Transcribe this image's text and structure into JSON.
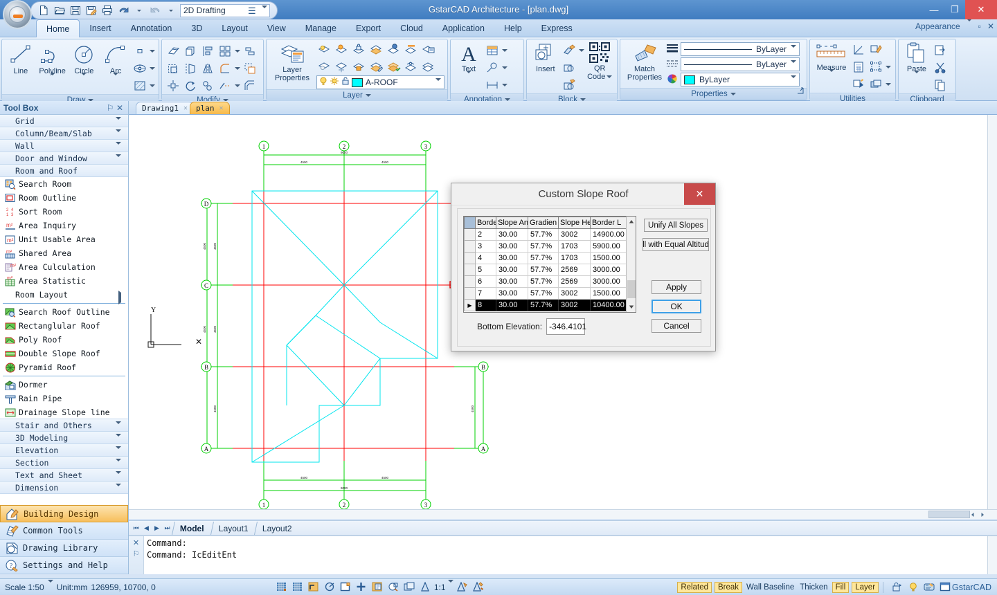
{
  "window": {
    "title": "GstarCAD Architecture - [plan.dwg]",
    "minimize": "—",
    "maximize": "❐",
    "close": "✕"
  },
  "quick_access": {
    "workspace_value": "2D Drafting",
    "icons": [
      "new-icon",
      "open-icon",
      "save-icon",
      "save-as-icon",
      "print-icon",
      "undo-icon",
      "redo-icon"
    ],
    "more_label": "☰"
  },
  "ribbon": {
    "tabs": [
      {
        "label": "Home",
        "active": true
      },
      {
        "label": "Insert",
        "active": false
      },
      {
        "label": "Annotation",
        "active": false
      },
      {
        "label": "3D",
        "active": false
      },
      {
        "label": "Layout",
        "active": false
      },
      {
        "label": "View",
        "active": false
      },
      {
        "label": "Manage",
        "active": false
      },
      {
        "label": "Export",
        "active": false
      },
      {
        "label": "Cloud",
        "active": false
      },
      {
        "label": "Application",
        "active": false
      },
      {
        "label": "Help",
        "active": false
      },
      {
        "label": "Express",
        "active": false
      }
    ],
    "appearance_label": "Appearance",
    "panels": {
      "draw": {
        "title": "Draw",
        "buttons": [
          "Line",
          "Polyline",
          "Circle",
          "Arc"
        ],
        "extra_icons": [
          "rectangle-icon",
          "ellipse-icon",
          "hatch-icon"
        ]
      },
      "modify": {
        "title": "Modify",
        "icons": [
          "erase-icon",
          "copy-icon",
          "align-icon",
          "array-icon",
          "offset-icon",
          "scale-icon",
          "stretch-icon",
          "mirror-icon",
          "fillet-icon",
          "explode-icon",
          "move-icon",
          "rotate-icon",
          "trim-icon",
          "extend-icon",
          "chamfer-icon"
        ]
      },
      "layer": {
        "title": "Layer",
        "main_label_line1": "Layer",
        "main_label_line2": "Properties",
        "current_layer": "A-ROOF",
        "layer_color": "#00ffff",
        "icons": [
          "layer-on-icon",
          "layer-freeze-icon",
          "layer-lock-icon",
          "layer-iso-icon",
          "layer-match-icon",
          "layer-prev-icon",
          "layer-state-icon",
          "layer-off-icon",
          "layer-thaw-icon",
          "layer-unlock-icon",
          "layer-change-icon",
          "layer-merge-icon",
          "layer-walk-icon",
          "layer-delete-icon"
        ]
      },
      "annotation": {
        "title": "Annotation",
        "main_label": "Text",
        "icons": [
          "table-icon",
          "leader-icon",
          "dimension-icon"
        ]
      },
      "block": {
        "title": "Block",
        "insert_label": "Insert",
        "qr_label_line1": "QR",
        "qr_label_line2": "Code",
        "icons": [
          "block-edit-icon",
          "block-define-icon",
          "block-attribute-icon",
          "qr-code-icon"
        ]
      },
      "properties": {
        "title": "Properties",
        "match_label_line1": "Match",
        "match_label_line2": "Properties",
        "color_value": "ByLayer",
        "linetype_value": "ByLayer",
        "lineweight_value": "ByLayer",
        "swatch_color": "#00ffff"
      },
      "utilities": {
        "title": "Utilities",
        "measure_label": "Measure",
        "icons": [
          "distance-icon",
          "ruler-icon",
          "coordinate-icon",
          "quick-select-icon",
          "calculator-icon",
          "point-icon",
          "group-icon",
          "overlap-icon"
        ]
      },
      "clipboard": {
        "title": "Clipboard",
        "paste_label": "Paste",
        "icons": [
          "copy-clip-icon",
          "cut-icon",
          "copy-icon"
        ]
      }
    }
  },
  "document_tabs": [
    {
      "label": "Drawing1",
      "active": false,
      "close": "✕"
    },
    {
      "label": "plan",
      "active": true,
      "close": "✕"
    }
  ],
  "toolbox": {
    "title": "Tool Box",
    "pin": "⚐",
    "close": "✕",
    "groups_top": [
      {
        "label": "Grid",
        "expanded": false
      },
      {
        "label": "Column/Beam/Slab",
        "expanded": false
      },
      {
        "label": "Wall",
        "expanded": false
      },
      {
        "label": "Door and Window",
        "expanded": false
      },
      {
        "label": "Room and Roof",
        "expanded": true
      }
    ],
    "items": [
      {
        "label": "Search Room",
        "icon": "search-room-icon",
        "submenu": false
      },
      {
        "label": "Room Outline",
        "icon": "room-outline-icon",
        "submenu": false
      },
      {
        "label": "Sort Room",
        "icon": "sort-room-icon",
        "submenu": false
      },
      {
        "label": "Area Inquiry",
        "icon": "area-inquiry-icon",
        "submenu": false
      },
      {
        "label": "Unit Usable Area",
        "icon": "unit-usable-area-icon",
        "submenu": false
      },
      {
        "label": "Shared Area",
        "icon": "shared-area-icon",
        "submenu": false
      },
      {
        "label": "Area Culculation",
        "icon": "area-calculation-icon",
        "submenu": false
      },
      {
        "label": "Area Statistic",
        "icon": "area-statistic-icon",
        "submenu": false
      },
      {
        "label": "Room Layout",
        "icon": "none",
        "submenu": true
      }
    ],
    "items2": [
      {
        "label": "Search Roof Outline",
        "icon": "search-roof-outline-icon"
      },
      {
        "label": "Rectanglular Roof",
        "icon": "rectangular-roof-icon"
      },
      {
        "label": "Poly Roof",
        "icon": "poly-roof-icon"
      },
      {
        "label": "Double Slope Roof",
        "icon": "double-slope-roof-icon"
      },
      {
        "label": "Pyramid Roof",
        "icon": "pyramid-roof-icon"
      }
    ],
    "items3": [
      {
        "label": "Dormer",
        "icon": "dormer-icon"
      },
      {
        "label": "Rain Pipe",
        "icon": "rain-pipe-icon"
      },
      {
        "label": "Drainage Slope line",
        "icon": "drainage-slope-line-icon"
      }
    ],
    "groups_bottom": [
      {
        "label": "Stair and Others"
      },
      {
        "label": "3D Modeling"
      },
      {
        "label": "Elevation"
      },
      {
        "label": "Section"
      },
      {
        "label": "Text and Sheet"
      },
      {
        "label": "Dimension"
      }
    ],
    "categories": [
      {
        "label": "Building Design",
        "icon": "building-design-icon",
        "selected": true
      },
      {
        "label": "Common Tools",
        "icon": "common-tools-icon",
        "selected": false
      },
      {
        "label": "Drawing Library",
        "icon": "drawing-library-icon",
        "selected": false
      },
      {
        "label": "Settings and Help",
        "icon": "settings-help-icon",
        "selected": false
      }
    ]
  },
  "dialog": {
    "title": "Custom Slope Roof",
    "close": "✕",
    "columns": [
      "",
      "Borde",
      "Slope Ang",
      "Gradien",
      "Slope Hei",
      "Border L"
    ],
    "rows": [
      {
        "marker": "",
        "border": "2",
        "slope_angle": "30.00",
        "gradient": "57.7%",
        "slope_height": "3002",
        "border_length": "14900.00",
        "selected": false
      },
      {
        "marker": "",
        "border": "3",
        "slope_angle": "30.00",
        "gradient": "57.7%",
        "slope_height": "1703",
        "border_length": "5900.00",
        "selected": false
      },
      {
        "marker": "",
        "border": "4",
        "slope_angle": "30.00",
        "gradient": "57.7%",
        "slope_height": "1703",
        "border_length": "1500.00",
        "selected": false
      },
      {
        "marker": "",
        "border": "5",
        "slope_angle": "30.00",
        "gradient": "57.7%",
        "slope_height": "2569",
        "border_length": "3000.00",
        "selected": false
      },
      {
        "marker": "",
        "border": "6",
        "slope_angle": "30.00",
        "gradient": "57.7%",
        "slope_height": "2569",
        "border_length": "3000.00",
        "selected": false
      },
      {
        "marker": "",
        "border": "7",
        "slope_angle": "30.00",
        "gradient": "57.7%",
        "slope_height": "3002",
        "border_length": "1500.00",
        "selected": false
      },
      {
        "marker": "▶",
        "border": "8",
        "slope_angle": "30.00",
        "gradient": "57.7%",
        "slope_height": "3002",
        "border_length": "10400.00",
        "selected": true
      }
    ],
    "bottom_elevation_label": "Bottom Elevation:",
    "bottom_elevation_value": "-346.4101",
    "buttons": {
      "unify": "Unify All Slopes",
      "equal_altitude": "ll with Equal Altitud",
      "apply": "Apply",
      "ok": "OK",
      "cancel": "Cancel"
    }
  },
  "canvas": {
    "colors": {
      "axis": "#00ff00",
      "grid": "#ff0000",
      "roof": "#00ffff",
      "background": "#ffffff",
      "grip": "#ff0000"
    },
    "grid_labels_top": [
      "1",
      "2",
      "3"
    ],
    "grid_labels_bottom": [
      "1",
      "2",
      "3"
    ],
    "grid_labels_left": [
      "D",
      "C",
      "B",
      "A"
    ],
    "grid_labels_right": [
      "B",
      "A"
    ],
    "dim_top_total": "9000",
    "dim_top_left": "4500",
    "dim_top_right": "4500",
    "dim_bottom_total": "9000",
    "dim_bottom_left": "4500",
    "dim_bottom_right": "4500",
    "dim_left_upper": "4500",
    "dim_left_lower": "4500",
    "dim_right": "4500",
    "ucs_x": "X",
    "ucs_y": "Y"
  },
  "layout_tabs": {
    "nav": [
      "⏮",
      "◀",
      "▶",
      "⏭"
    ],
    "tabs": [
      {
        "label": "Model",
        "active": true
      },
      {
        "label": "Layout1",
        "active": false
      },
      {
        "label": "Layout2",
        "active": false
      }
    ]
  },
  "command_window": {
    "close": "✕",
    "pin": "⚐",
    "lines": [
      "Command:",
      "Command: IcEditEnt",
      ""
    ]
  },
  "statusbar": {
    "scale_label": "Scale 1:50",
    "unit_label": "Unit:mm",
    "coordinates": "126959, 10700, 0",
    "annotation_scale": "1:1",
    "toggle_icons": [
      "snap-icon",
      "grid-icon",
      "ortho-icon",
      "polar-icon",
      "osnap-icon",
      "otrack-icon",
      "dynamic-input-icon",
      "lineweight-icon",
      "quick-properties-icon",
      "model-space-icon",
      "annotation-visibility-icon",
      "annotation-scale-icon",
      "annotation-auto-icon"
    ],
    "tags": [
      {
        "label": "Related",
        "highlight": true
      },
      {
        "label": "Break",
        "highlight": true
      },
      {
        "label": "Wall Baseline",
        "highlight": false
      },
      {
        "label": "Thicken",
        "highlight": false
      },
      {
        "label": "Fill",
        "highlight": true
      },
      {
        "label": "Layer",
        "highlight": true
      }
    ],
    "right_icons": [
      "lock-icon",
      "bulb-icon",
      "clean-screen-icon",
      "window-icon"
    ],
    "brand": "GstarCAD"
  }
}
